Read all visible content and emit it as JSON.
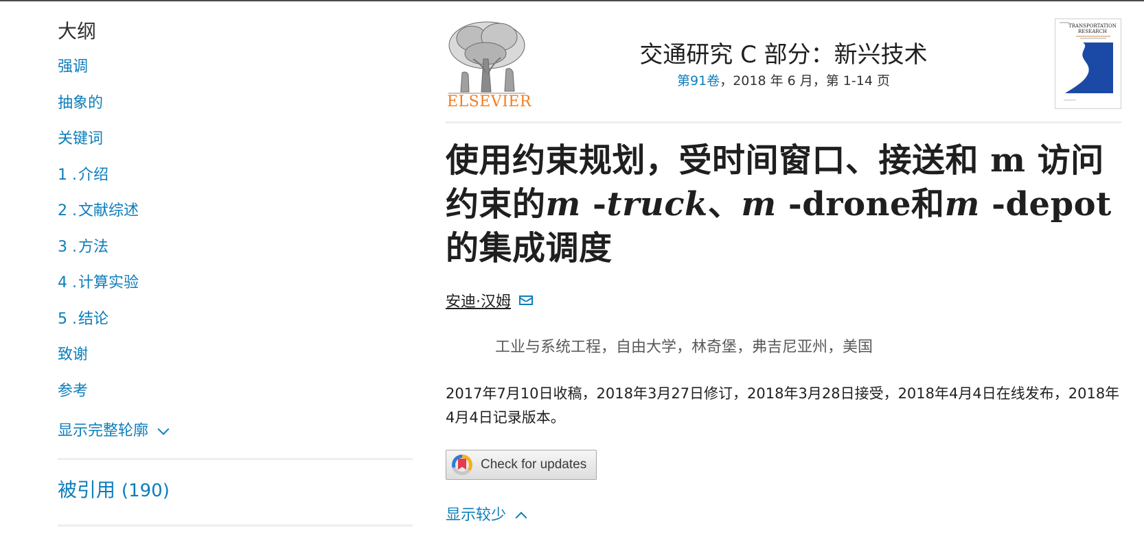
{
  "sidebar": {
    "outline_title": "大纲",
    "items": [
      {
        "num": "",
        "label": "强调"
      },
      {
        "num": "",
        "label": "抽象的"
      },
      {
        "num": "",
        "label": "关键词"
      },
      {
        "num": "1 .",
        "label": "介绍"
      },
      {
        "num": "2 .",
        "label": "文献综述"
      },
      {
        "num": "3 .",
        "label": "方法"
      },
      {
        "num": "4 .",
        "label": "计算实验"
      },
      {
        "num": "5 .",
        "label": "结论"
      },
      {
        "num": "",
        "label": "致谢"
      },
      {
        "num": "",
        "label": "参考"
      }
    ],
    "show_full_label": "显示完整轮廓",
    "cited_label": "被引用",
    "cited_count": "(190)"
  },
  "header": {
    "publisher": "ELSEVIER",
    "journal_title": "交通研究 C 部分：新兴技术",
    "volume_link": "第91卷",
    "issue_rest": "，2018 年 6 月，第 1-14 页",
    "cover_lines": [
      "TRANSPORTATION",
      "RESEARCH"
    ]
  },
  "article": {
    "title_parts": {
      "p1": "使用约束规划，受时间窗口、接送和 m 访问约束的",
      "m1": "m",
      "p2": " -",
      "truck": "truck",
      "p3": "、",
      "m2": "m",
      "p4": " -drone和",
      "m3": "m",
      "p5": " -depot的集成调度"
    },
    "author": "安迪·汉姆",
    "affiliation": "工业与系统工程，自由大学，林奇堡，弗吉尼亚州，美国",
    "dates": "2017年7月10日收稿，2018年3月27日修订，2018年3月28日接受，2018年4月4日在线发布，2018年4月4日记录版本。",
    "check_updates_label": "Check for updates",
    "show_less_label": "显示较少"
  },
  "colors": {
    "link": "#0c7dbb",
    "elsevier_orange": "#f47d20",
    "cover_blue": "#1a4aa6"
  }
}
